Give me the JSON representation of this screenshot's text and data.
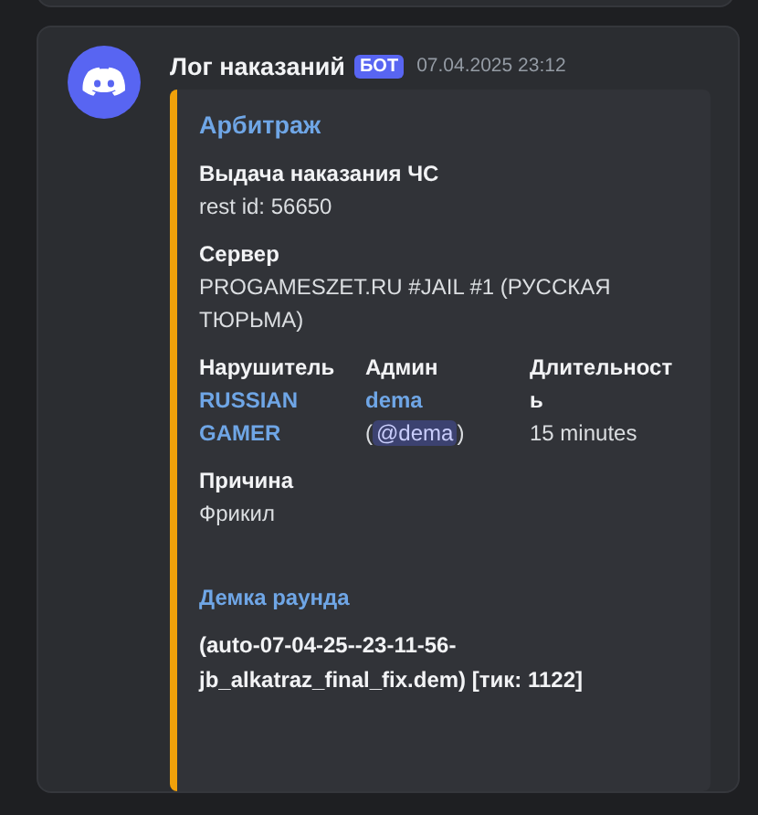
{
  "message": {
    "author": "Лог наказаний",
    "badge": "БОТ",
    "timestamp": "07.04.2025 23:12",
    "embed": {
      "title": "Арбитраж",
      "fields": [
        {
          "kind": "plain",
          "name": "Выдача наказания ЧС",
          "value": "rest id: 56650"
        },
        {
          "kind": "plain",
          "name": "Сервер",
          "value": "PROGAMESZET.RU #JAIL #1 (РУССКАЯ ТЮРЬМА)"
        },
        {
          "kind": "user",
          "name": "Нарушитель",
          "value": "RUSSIAN GAMER",
          "inline": true
        },
        {
          "kind": "admin",
          "name": "Админ",
          "value": "dema",
          "mention": "@dema",
          "mention_open": "(",
          "mention_close": ")",
          "inline": true
        },
        {
          "kind": "plain",
          "name": "Длительность",
          "value": "15 minutes",
          "inline": true
        },
        {
          "kind": "plain",
          "name": "Причина",
          "value": "Фрикил"
        }
      ],
      "section": {
        "title": "Демка раунда",
        "value": "(auto-07-04-25--23-11-56-jb_alkatraz_final_fix.dem) [тик: 1122]"
      }
    }
  }
}
